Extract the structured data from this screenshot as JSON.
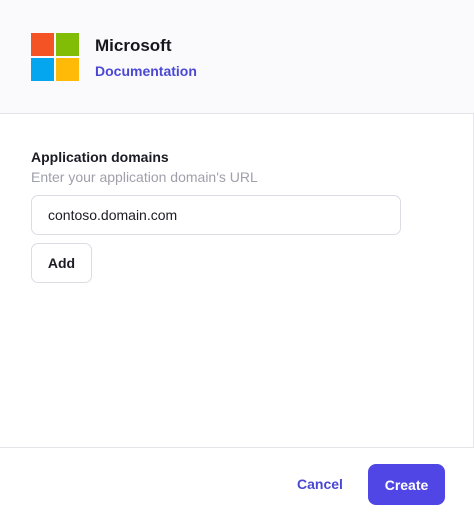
{
  "header": {
    "app_name": "Microsoft",
    "documentation_link": "Documentation",
    "logo_icon": "microsoft-logo-icon",
    "logo_colors": [
      "#f35325",
      "#81bc06",
      "#05a6f0",
      "#ffba08"
    ]
  },
  "form": {
    "label": "Application domains",
    "hint": "Enter your application domain's URL",
    "domain_value": "contoso.domain.com",
    "add_label": "Add"
  },
  "footer": {
    "cancel_label": "Cancel",
    "create_label": "Create"
  },
  "colors": {
    "accent": "#4f46e5",
    "link": "#4a48d3"
  }
}
